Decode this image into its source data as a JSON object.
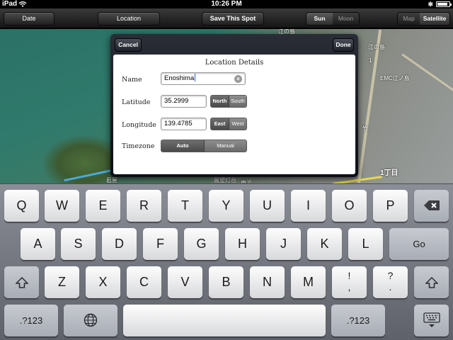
{
  "status_bar": {
    "device": "iPad",
    "time": "10:26 PM",
    "bluetooth": "✱",
    "battery_level": 0.9
  },
  "toolbar": {
    "date_label": "Date",
    "location_label": "Location",
    "save_label": "Save This Spot",
    "sun_label": "Sun",
    "moon_label": "Moon",
    "map_label": "Map",
    "satellite_label": "Satellite",
    "selected_body": "Sun",
    "selected_map_type": "Satellite"
  },
  "map": {
    "labels": [
      "江の島",
      "EMC江ノ島",
      "1丁目",
      "竹",
      "江の島",
      "岩屋",
      "展望灯台",
      "東浜",
      "1"
    ]
  },
  "dialog": {
    "cancel_label": "Cancel",
    "done_label": "Done",
    "title": "Location Details",
    "name_label": "Name",
    "name_value": "Enoshima",
    "latitude_label": "Latitude",
    "latitude_value": "35.2999",
    "north_label": "North",
    "south_label": "South",
    "latitude_hemisphere": "North",
    "longitude_label": "Longitude",
    "longitude_value": "139.4785",
    "east_label": "East",
    "west_label": "West",
    "longitude_hemisphere": "East",
    "timezone_label": "Timezone",
    "auto_label": "Auto",
    "manual_label": "Manual",
    "timezone_mode": "Auto"
  },
  "keyboard": {
    "row1": [
      "Q",
      "W",
      "E",
      "R",
      "T",
      "Y",
      "U",
      "I",
      "O",
      "P"
    ],
    "row2": [
      "A",
      "S",
      "D",
      "F",
      "G",
      "H",
      "J",
      "K",
      "L"
    ],
    "row3": [
      "Z",
      "X",
      "C",
      "V",
      "B",
      "N",
      "M"
    ],
    "go_label": "Go",
    "numbers_label": ".?123",
    "exclaim_top": "!",
    "exclaim_bottom": ",",
    "question_top": "?",
    "question_bottom": ".",
    "backspace_icon": "backspace-icon",
    "shift_icon": "shift-icon",
    "globe_icon": "globe-icon",
    "dismiss_icon": "keyboard-dismiss-icon"
  }
}
